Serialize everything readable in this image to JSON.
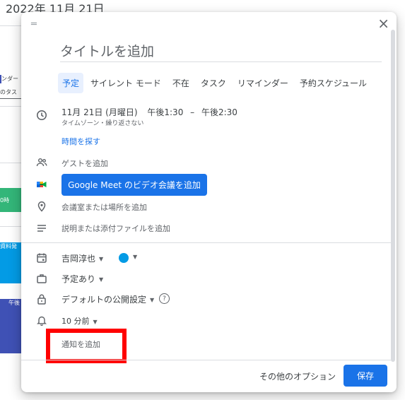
{
  "background": {
    "date_header": "2022年 11月 21日",
    "chips": [
      {
        "label": "ンダー",
        "color": "#ffffff",
        "text_color": "#3c4043"
      },
      {
        "label": "のタス",
        "color": "#ffffff",
        "text_color": "#3c4043"
      },
      {
        "label": "0時",
        "color": "#33b679",
        "text_color": "#ffffff"
      },
      {
        "label": "資料発",
        "color": "#039be5",
        "text_color": "#ffffff"
      },
      {
        "label": "午後",
        "color": "#3f51b5",
        "text_color": "#ffffff"
      }
    ]
  },
  "dialog": {
    "close_icon": "close-icon",
    "title_placeholder": "タイトルを追加",
    "tabs": [
      "予定",
      "サイレント モード",
      "不在",
      "タスク",
      "リマインダー",
      "予約スケジュール"
    ],
    "active_tab": "予定",
    "time": {
      "date": "11月 21日 (月曜日)",
      "start": "午後1:30",
      "separator": "–",
      "end": "午後2:30",
      "subtext": "タイムゾーン・繰り返さない"
    },
    "find_time_link": "時間を探す",
    "guests_placeholder": "ゲストを追加",
    "meet_button": "Google Meet のビデオ会議を追加",
    "location_placeholder": "会議室または場所を追加",
    "description_placeholder": "説明または添付ファイルを追加",
    "calendar_owner": "吉岡淳也",
    "event_color": "#039be5",
    "availability": "予定あり",
    "visibility": "デフォルトの公開設定",
    "help_icon_text": "?",
    "notification": "10 分前",
    "add_notification": "通知を追加",
    "more_options": "その他のオプション",
    "save": "保存"
  },
  "colors": {
    "accent": "#1a73e8",
    "highlight": "#ff0000"
  }
}
